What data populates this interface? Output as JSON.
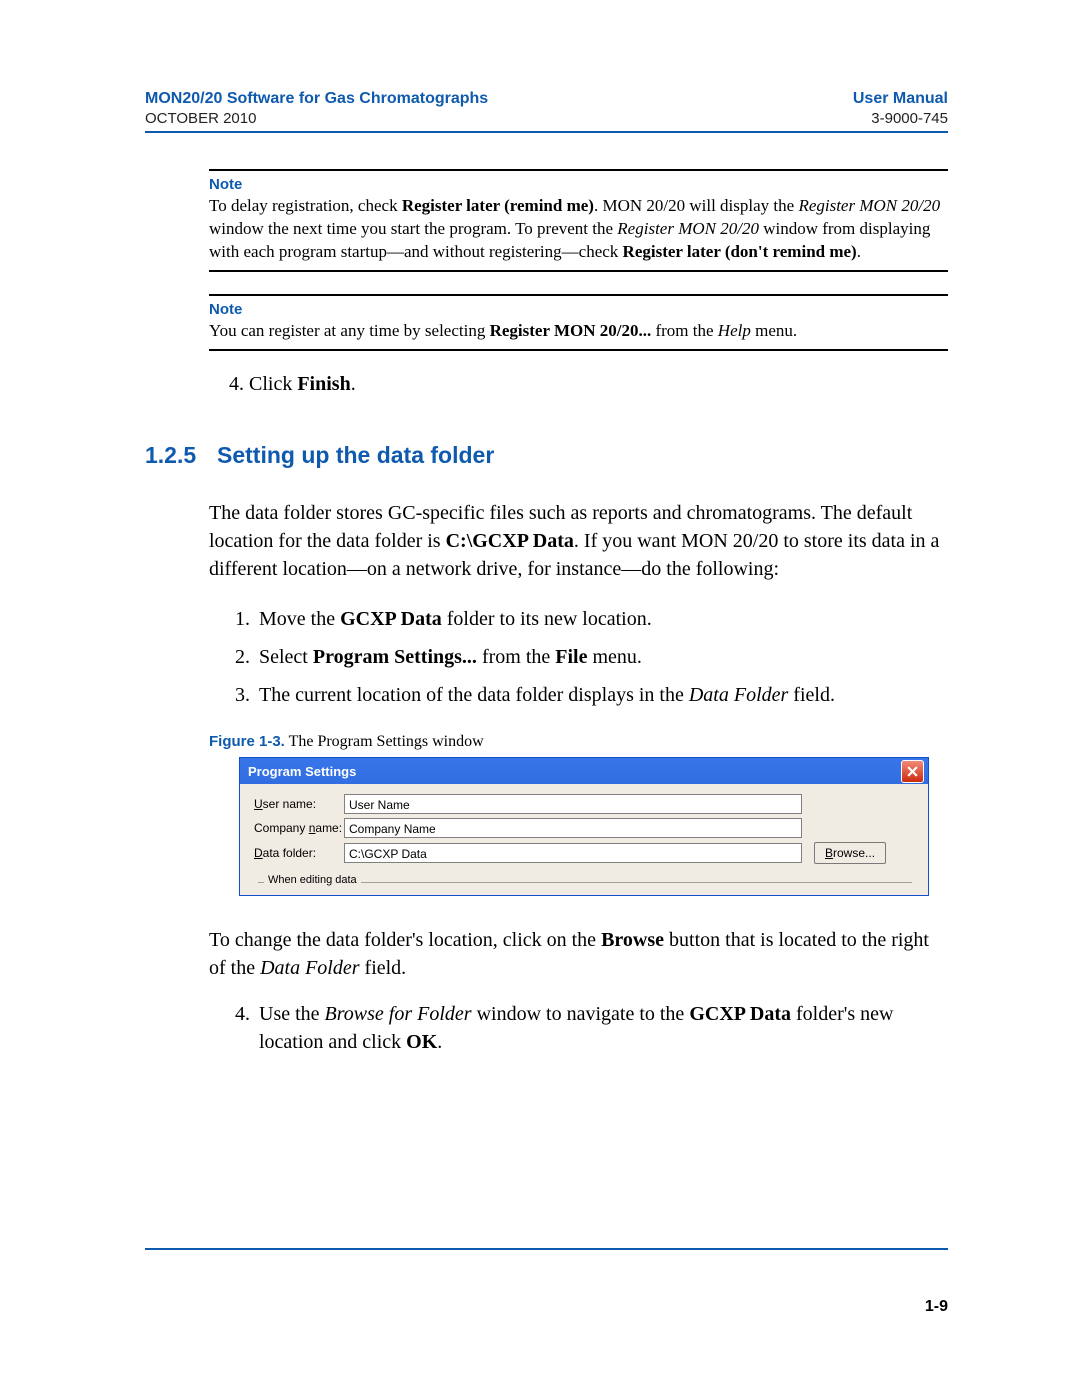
{
  "header": {
    "title_left": "MON20/20 Software for Gas Chromatographs",
    "title_right": "User Manual",
    "date": "OCTOBER 2010",
    "doc_number": "3-9000-745"
  },
  "note1": {
    "head": "Note",
    "line1_a": "To delay registration, check ",
    "line1_b": "Register later (remind me)",
    "line1_c": ".  MON 20/20 will display the ",
    "line2_a": "Register MON 20/20",
    "line2_b": " window the next time you start the program.  To prevent the ",
    "line3_a": "Register MON 20/20",
    "line3_b": " window from displaying with each program startup—and without registering—check ",
    "line3_c": "Register later (don't remind me)",
    "line3_d": "."
  },
  "note2": {
    "head": "Note",
    "a": "You can register at any time by selecting ",
    "b": "Register MON 20/20...",
    "c": " from the ",
    "d": "Help",
    "e": " menu."
  },
  "step4": {
    "num": "4. ",
    "a": "Click ",
    "b": "Finish",
    "c": "."
  },
  "section": {
    "num": "1.2.5",
    "title": "Setting up the data folder"
  },
  "intro": {
    "a": "The data folder stores GC-specific files such as reports and chromatograms.  The default location for the data folder is ",
    "b": "C:\\GCXP Data",
    "c": ".  If you want MON 20/20 to store its data in a different location—on a network drive, for instance—do the following:"
  },
  "list": {
    "i1": {
      "num": "1.",
      "a": "Move the ",
      "b": "GCXP Data",
      "c": " folder to its new location."
    },
    "i2": {
      "num": "2.",
      "a": "Select ",
      "b": "Program Settings...",
      "c": " from the ",
      "d": "File",
      "e": " menu."
    },
    "i3": {
      "num": "3.",
      "a": "The current location of the data folder displays in the ",
      "b": "Data Folder",
      "c": " field."
    }
  },
  "figure": {
    "label": "Figure 1-3.",
    "caption": "  The Program Settings window"
  },
  "window": {
    "title": "Program Settings",
    "user_label_pre": "U",
    "user_label_post": "ser name:",
    "company_label_pre": "Company ",
    "company_label_u": "n",
    "company_label_post": "ame:",
    "data_label_pre": "D",
    "data_label_post": "ata folder:",
    "user_value": "User Name",
    "company_value": "Company Name",
    "data_value": "C:\\GCXP Data",
    "browse_pre": "B",
    "browse_post": "rowse...",
    "group_title": "When editing data"
  },
  "post": {
    "a": "To change the data folder's location, click on the ",
    "b": "Browse",
    "c": " button that is located to the right of the ",
    "d": "Data Folder",
    "e": " field."
  },
  "step4b": {
    "num": "4.",
    "a": "Use the ",
    "b": "Browse for Folder",
    "c": " window to navigate to the ",
    "d": "GCXP Data",
    "e": " folder's new location and click ",
    "f": "OK",
    "g": "."
  },
  "footer": {
    "page": "1-9"
  }
}
